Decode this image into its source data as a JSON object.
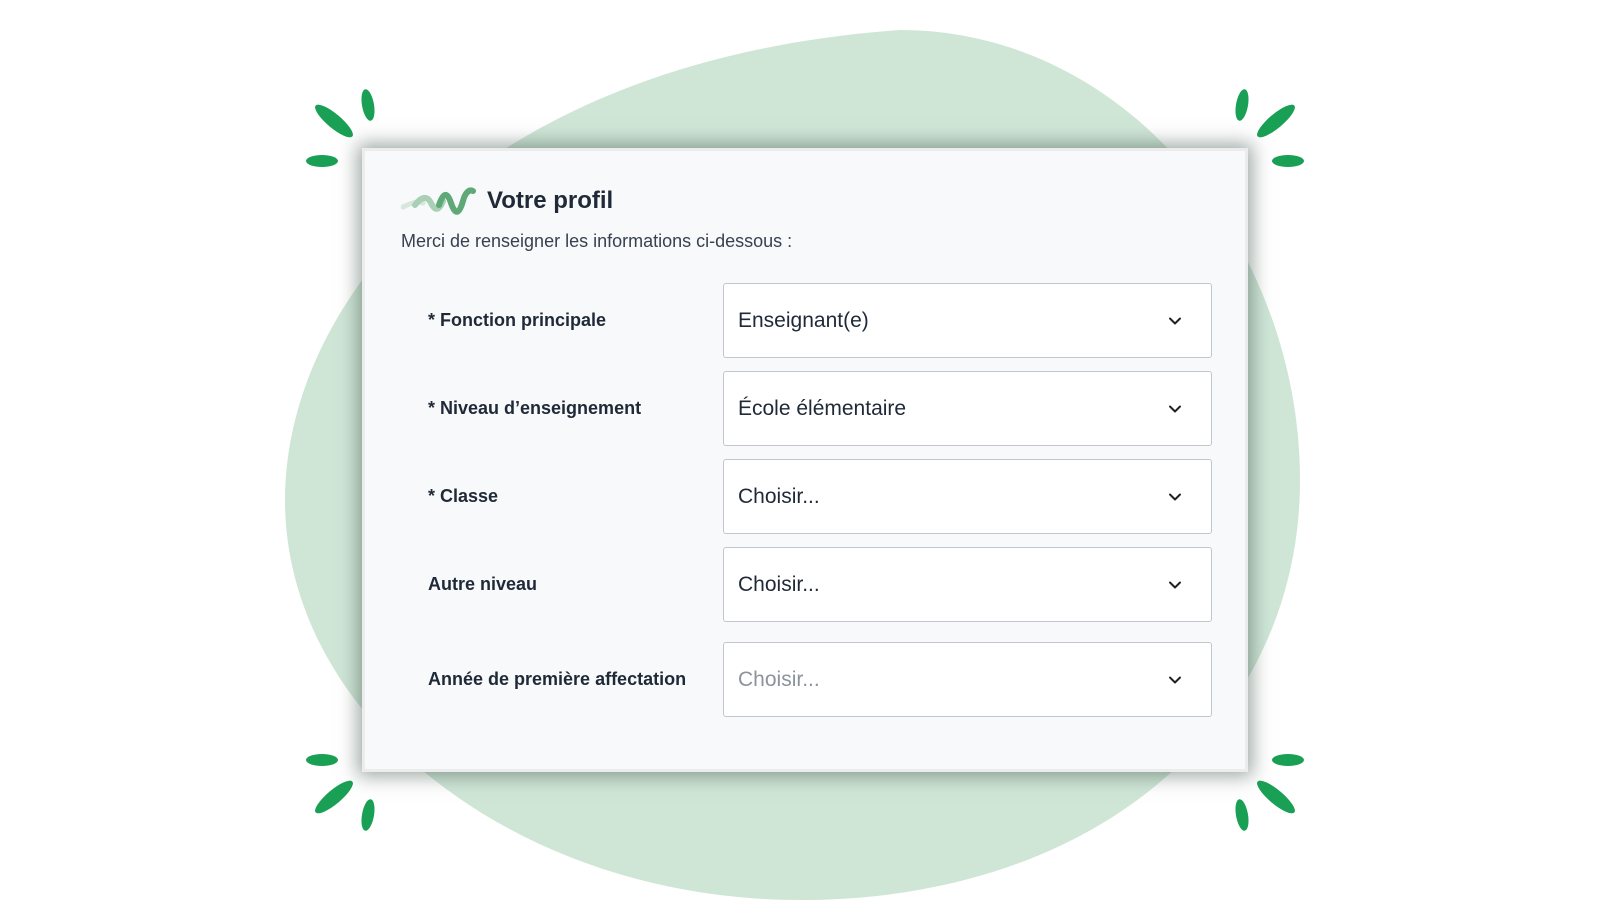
{
  "form": {
    "title": "Votre profil",
    "subtitle": "Merci de renseigner les informations ci-dessous :",
    "fields": [
      {
        "label": "* Fonction principale",
        "value": "Enseignant(e)",
        "is_placeholder": false
      },
      {
        "label": "* Niveau d’enseignement",
        "value": "École élémentaire",
        "is_placeholder": false
      },
      {
        "label": "* Classe",
        "value": "Choisir...",
        "is_placeholder": false
      },
      {
        "label": "Autre niveau",
        "value": "Choisir...",
        "is_placeholder": false
      },
      {
        "label": "Année de première affectation",
        "value": "Choisir...",
        "is_placeholder": true
      }
    ]
  },
  "icons": {
    "logo": "wave-logo-icon",
    "dropdown": "chevron-down-icon",
    "sparkles": "sparkle-accent-icon"
  },
  "colors": {
    "blob": "#cfe6d7",
    "accent": "#1aa055",
    "card_background": "#f8f9fa",
    "text": "#1f2937",
    "placeholder": "#8c939c"
  }
}
